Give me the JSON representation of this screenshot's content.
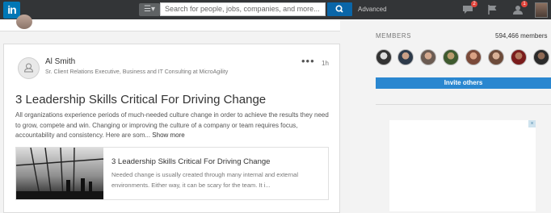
{
  "header": {
    "logo_text": "in",
    "menu_icon": "list-icon",
    "search_placeholder": "Search for people, jobs, companies, and more...",
    "search_icon": "search-icon",
    "advanced_label": "Advanced",
    "messages_badge": "2",
    "notifications_badge": "1"
  },
  "post": {
    "author_name": "Al Smith",
    "author_title": "Sr. Client Relations Executive, Business and IT Consulting at MicroAgility",
    "time": "1h",
    "more_label": "•••",
    "title": "3 Leadership Skills Critical For Driving Change",
    "body": "All organizations experience periods of much-needed culture change in order to achieve the results they need to grow, compete and win. Changing or improving the culture of a company or team requires focus, accountability and consistency. Here are som...",
    "show_more": "Show more",
    "link": {
      "title": "3 Leadership Skills Critical For Driving Change",
      "description": "Needed change is usually created through many internal and external environments. Either way, it can be scary for the team. It i..."
    }
  },
  "members": {
    "label": "MEMBERS",
    "count": "594,466 members",
    "invite_label": "Invite others"
  },
  "ad": {
    "close_label": "×"
  },
  "colors": {
    "topbar": "#333537",
    "brand": "#0077b5",
    "invite_button": "#2a87d0"
  }
}
